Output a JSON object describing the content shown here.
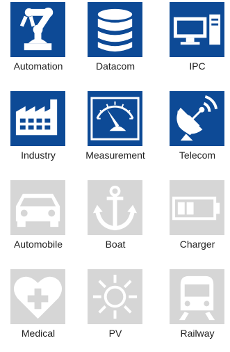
{
  "colors": {
    "active": "#0d4a96",
    "inactive": "#d6d6d6"
  },
  "tiles": [
    {
      "label": "Automation",
      "icon": "robot-arm-icon",
      "active": true
    },
    {
      "label": "Datacom",
      "icon": "database-icon",
      "active": true
    },
    {
      "label": "IPC",
      "icon": "computer-icon",
      "active": true
    },
    {
      "label": "Industry",
      "icon": "factory-icon",
      "active": true
    },
    {
      "label": "Measurement",
      "icon": "gauge-icon",
      "active": true
    },
    {
      "label": "Telecom",
      "icon": "satellite-dish-icon",
      "active": true
    },
    {
      "label": "Automobile",
      "icon": "car-icon",
      "active": false
    },
    {
      "label": "Boat",
      "icon": "anchor-icon",
      "active": false
    },
    {
      "label": "Charger",
      "icon": "battery-icon",
      "active": false
    },
    {
      "label": "Medical",
      "icon": "medical-heart-icon",
      "active": false
    },
    {
      "label": "PV",
      "icon": "sun-icon",
      "active": false
    },
    {
      "label": "Railway",
      "icon": "train-icon",
      "active": false
    }
  ]
}
